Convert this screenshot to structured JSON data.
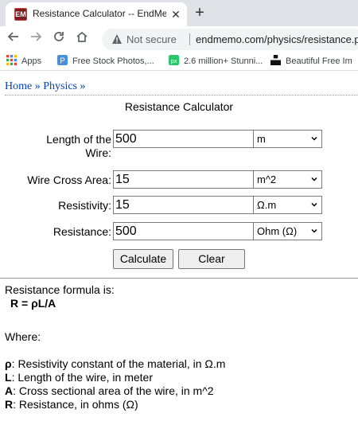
{
  "browser": {
    "tab_favicon": "EM",
    "tab_title": "Resistance Calculator -- EndMem",
    "tab_close": "✕",
    "new_tab": "+",
    "not_secure": "Not secure",
    "url": "endmemo.com/physics/resistance.ph",
    "bookmarks": [
      {
        "label": "Apps",
        "icon": "apps-grid-icon"
      },
      {
        "label": "Free Stock Photos,...",
        "icon": "pexels-icon"
      },
      {
        "label": "2.6 million+ Stunni...",
        "icon": "pixabay-icon"
      },
      {
        "label": "Beautiful Free Im",
        "icon": "unsplash-icon"
      }
    ]
  },
  "page": {
    "breadcrumb": {
      "home": "Home",
      "sep": "»",
      "physics": "Physics",
      "sep2": "»"
    },
    "title": "Resistance Calculator",
    "rows": [
      {
        "label": "Length of the Wire:",
        "value": "500",
        "unit": "m"
      },
      {
        "label": "Wire Cross Area:",
        "value": "15",
        "unit": "m^2"
      },
      {
        "label": "Resistivity:",
        "value": "15",
        "unit": "Ω.m"
      },
      {
        "label": "Resistance:",
        "value": "500",
        "unit": "Ohm (Ω)"
      }
    ],
    "buttons": {
      "calculate": "Calculate",
      "clear": "Clear"
    },
    "formula_intro": "Resistance formula is:",
    "formula": "R = ρL/A",
    "where": "Where:",
    "definitions": [
      {
        "sym": "ρ",
        "text": ": Resistivity constant of the material, in Ω.m"
      },
      {
        "sym": "L",
        "text": ": Length of the wire, in meter"
      },
      {
        "sym": "A",
        "text": ": Cross sectional area of the wire, in m^2"
      },
      {
        "sym": "R",
        "text": ": Resistance, in ohms (Ω)"
      }
    ]
  }
}
